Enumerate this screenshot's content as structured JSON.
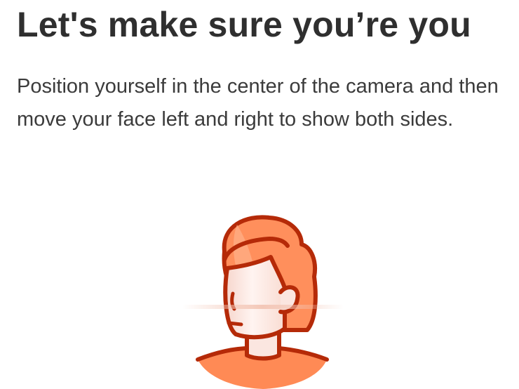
{
  "header": {
    "title": "Let's make sure you’re you"
  },
  "body": {
    "instructions": "Position yourself in the center of the camera and then move your face left and right to show both sides."
  },
  "illustration": {
    "icon": "face-scan-illustration",
    "colors": {
      "hair": "#ff8f5c",
      "hair_highlight": "#ffb08a",
      "outline": "#b52a08",
      "skin": "#fbe6e0",
      "shoulders": "#ff8a55",
      "scan_line": "#f2c3b2"
    }
  }
}
